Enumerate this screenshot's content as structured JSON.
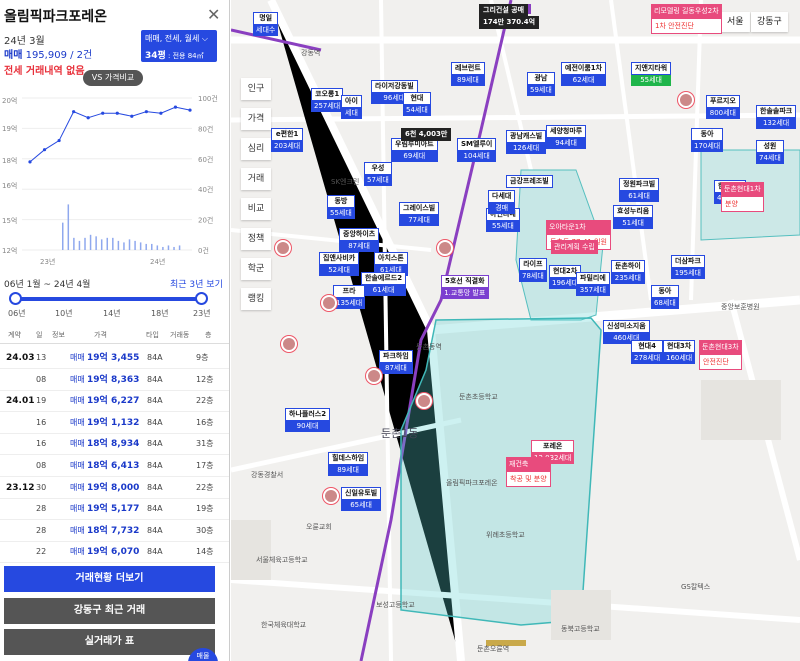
{
  "panel": {
    "title": "올림픽파크포레온",
    "close": "✕",
    "date": "24년 3월",
    "price_kind": "매매",
    "price_rest": " 195,909 / 2건",
    "no_rent": "전세 거래내역 없음",
    "filter_line1": "매매, 전세, 월세 ⌵",
    "filter_area": "34평",
    "filter_area_sub": " : 전용 84㎡",
    "vs_button": "VS 가격비교"
  },
  "chart_data": {
    "type": "line",
    "x_tick_labels": [
      "23년",
      "24년"
    ],
    "y_left_ticks": [
      "20억",
      "19억",
      "18억",
      "16억",
      "15억",
      "12억",
      "10억"
    ],
    "y_right_ticks": [
      "100건",
      "80건",
      "60건",
      "40건",
      "20건",
      "0건"
    ],
    "price_series": [
      15.8,
      16.6,
      17.2,
      19.1,
      18.7,
      19.0,
      19.0,
      18.8,
      19.1,
      19.0,
      19.4,
      19.2
    ],
    "volume_series": [
      18,
      30,
      8,
      6,
      8,
      10,
      9,
      7,
      8,
      8,
      6,
      5,
      7,
      6,
      5,
      4,
      4,
      3,
      2,
      3,
      2,
      3
    ],
    "ylim_left": [
      10,
      20
    ],
    "ylim_right": [
      0,
      100
    ]
  },
  "range": {
    "label": "06년 1월 ~ 24년 4월",
    "recent": "최근 3년 보기",
    "ticks": [
      "06년",
      "10년",
      "14년",
      "18년",
      "23년"
    ]
  },
  "table": {
    "headers": [
      "계약",
      "일",
      "정보",
      "가격",
      "타입",
      "거래동",
      "층"
    ],
    "rows": [
      {
        "ym": "24.03",
        "d": "13",
        "kind": "매매",
        "amt": "19억 3,455",
        "type": "84A",
        "fl": "9층"
      },
      {
        "ym": "",
        "d": "08",
        "kind": "매매",
        "amt": "19억 8,363",
        "type": "84A",
        "fl": "12층"
      },
      {
        "ym": "24.01",
        "d": "19",
        "kind": "매매",
        "amt": "19억 6,227",
        "type": "84A",
        "fl": "22층"
      },
      {
        "ym": "",
        "d": "16",
        "kind": "매매",
        "amt": "19억 1,132",
        "type": "84A",
        "fl": "16층"
      },
      {
        "ym": "",
        "d": "16",
        "kind": "매매",
        "amt": "18억 8,934",
        "type": "84A",
        "fl": "31층"
      },
      {
        "ym": "",
        "d": "08",
        "kind": "매매",
        "amt": "18억 6,413",
        "type": "84A",
        "fl": "17층"
      },
      {
        "ym": "23.12",
        "d": "30",
        "kind": "매매",
        "amt": "19억 8,000",
        "type": "84A",
        "fl": "22층"
      },
      {
        "ym": "",
        "d": "28",
        "kind": "매매",
        "amt": "19억 5,177",
        "type": "84A",
        "fl": "19층"
      },
      {
        "ym": "",
        "d": "28",
        "kind": "매매",
        "amt": "18억 7,732",
        "type": "84A",
        "fl": "30층"
      },
      {
        "ym": "",
        "d": "22",
        "kind": "매매",
        "amt": "19억 6,070",
        "type": "84A",
        "fl": "14층"
      }
    ]
  },
  "buttons": {
    "more": "거래현황 더보기",
    "district": "강동구 최근 거래",
    "table": "실거래가 표",
    "fab": "매물"
  },
  "map": {
    "top_controls": {
      "city": "서울",
      "district": "강동구"
    },
    "side_tabs": [
      "인구",
      "가격",
      "심리",
      "거래",
      "비교",
      "정책",
      "학군",
      "랭킹"
    ],
    "markers": [
      {
        "t": "명일",
        "b": "세대수"
      },
      {
        "t": "코오롱1",
        "b": "257세대"
      },
      {
        "t": "라이저강동빌",
        "b": "96세대"
      },
      {
        "t": "아이",
        "b": "세대"
      },
      {
        "t": "현대",
        "b": "54세대"
      },
      {
        "t": "레브런트",
        "b": "89세대"
      },
      {
        "t": "광남",
        "b": "59세대"
      },
      {
        "t": "예전이룸1차",
        "b": "62세대"
      },
      {
        "t": "지앤지타워",
        "b": "55세대"
      },
      {
        "t": "푸르지오",
        "b": "800세대"
      },
      {
        "t": "한솔솔파크",
        "b": "132세대"
      },
      {
        "t": "e편한1",
        "b": "203세대"
      },
      {
        "t": "우림루미아트",
        "b": "69세대"
      },
      {
        "t": "SM엘루이",
        "b": "104세대"
      },
      {
        "t": "광남캐스빌",
        "b": "126세대"
      },
      {
        "t": "세양청마루",
        "b": "94세대"
      },
      {
        "t": "동아",
        "b": "170세대"
      },
      {
        "t": "성원",
        "b": "74세대"
      },
      {
        "t": "우성",
        "b": "57세대"
      },
      {
        "t": "동방",
        "b": "55세대"
      },
      {
        "t": "그레이스빌",
        "b": "77세대"
      },
      {
        "t": "아인리베",
        "b": "55세대"
      },
      {
        "t": "정원파크빌",
        "b": "61세대"
      },
      {
        "t": "현대1차",
        "b": "498세대"
      },
      {
        "t": "중앙하이츠",
        "b": "87세대"
      },
      {
        "t": "효성누리움",
        "b": "51세대"
      },
      {
        "t": "집앤사비카",
        "b": "52세대"
      },
      {
        "t": "아치스톤",
        "b": "61세대"
      },
      {
        "t": "라이프",
        "b": "78세대"
      },
      {
        "t": "현대2차",
        "b": "196세대"
      },
      {
        "t": "둔촌하이",
        "b": "235세대"
      },
      {
        "t": "더삼파크",
        "b": "195세대"
      },
      {
        "t": "한솔에르드2",
        "b": "61세대"
      },
      {
        "t": "파밀리에",
        "b": "357세대"
      },
      {
        "t": "동아",
        "b": "68세대"
      },
      {
        "t": "프라",
        "b": "135세대"
      },
      {
        "t": "신성미소지움",
        "b": "460세대"
      },
      {
        "t": "현대3차",
        "b": "160세대"
      },
      {
        "t": "현대4",
        "b": "278세대"
      },
      {
        "t": "파크하임",
        "b": "87세대"
      },
      {
        "t": "하나플러스2",
        "b": "90세대"
      },
      {
        "t": "힐데스하임",
        "b": "89세대"
      },
      {
        "t": "신일유토빌",
        "b": "65세대"
      },
      {
        "t": "금강프레조빌",
        "b": ""
      },
      {
        "t": "다세대",
        "b": "경매"
      },
      {
        "t": "포레온",
        "b": "12,032세대"
      },
      {
        "t": "5호선 직결화",
        "b": "1.교통망 발표"
      }
    ],
    "dark_tags": [
      "6천 4,003만",
      "174만 370.4억",
      "그리건설 공매"
    ],
    "red_tags": [
      {
        "t": "리모델링 길동우성2차",
        "b": "1차 안전진단"
      },
      {
        "t": "오아타운1차",
        "b": "둔촌동 77-41 일원"
      },
      {
        "t": "관리계획 수립",
        "b": ""
      },
      {
        "t": "재건축",
        "b": "착공 및 분양"
      },
      {
        "t": "둔촌현대1차",
        "b": "분양"
      },
      {
        "t": "둔촌현대3차",
        "b": "안전진단"
      }
    ],
    "labels": {
      "dunchon1dong": "둔촌1동",
      "dunchon_station": "둔촌동역",
      "dunchon_oryun": "둔촌오륜역",
      "olympic_park": "올림픽파크포레온",
      "gangdong_station": "강동역",
      "school1": "둔촌초등학교",
      "school2": "위례초등학교",
      "school3": "동북고등학교",
      "school4": "보성고등학교",
      "hospital": "중앙보훈병원",
      "sk": "SK엔크린",
      "gangdong_office": "강동경찰서",
      "seoul_school": "서울체육고등학교",
      "korea_univ": "한국체육대학교",
      "orun_church": "오륜교회",
      "gs": "GS칼텍스"
    }
  }
}
